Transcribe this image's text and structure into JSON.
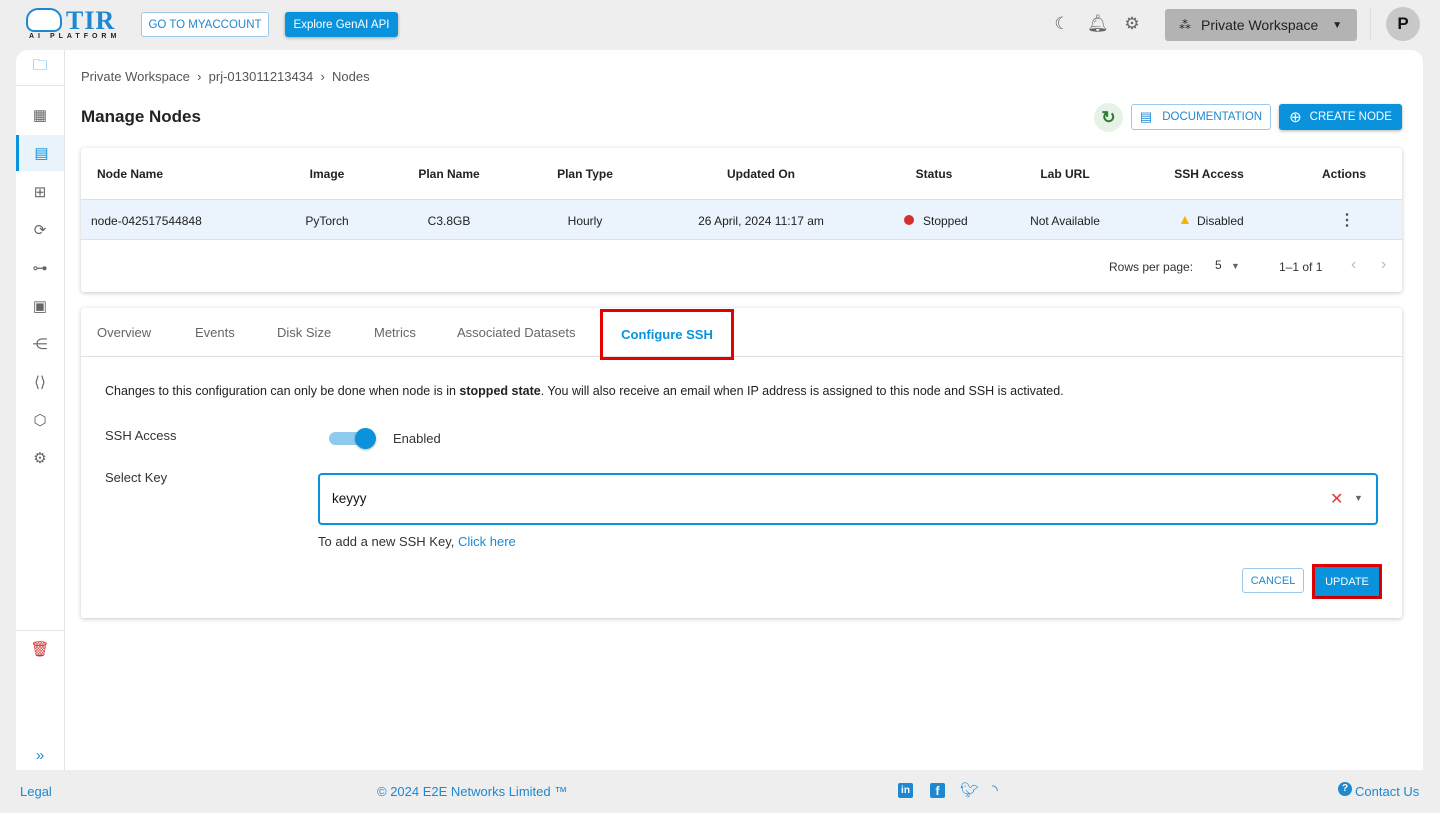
{
  "header": {
    "logo_text": "TIR",
    "logo_sub": "AI PLATFORM",
    "myaccount": "GO TO MYACCOUNT",
    "genai": "Explore GenAI API",
    "workspace": "Private Workspace",
    "avatar": "P"
  },
  "breadcrumb": [
    "Private Workspace",
    "prj-013011213434",
    "Nodes"
  ],
  "page": {
    "title": "Manage Nodes",
    "documentation": "DOCUMENTATION",
    "create": "CREATE NODE"
  },
  "table": {
    "columns": [
      "Node Name",
      "Image",
      "Plan Name",
      "Plan Type",
      "Updated On",
      "Status",
      "Lab URL",
      "SSH Access",
      "Actions"
    ],
    "rows": [
      {
        "name": "node-042517544848",
        "image": "PyTorch",
        "plan": "C3.8GB",
        "type": "Hourly",
        "updated": "26 April, 2024 11:17 am",
        "status": "Stopped",
        "lab": "Not Available",
        "ssh": "Disabled"
      }
    ],
    "rows_per_page_label": "Rows per page:",
    "rows_per_page": "5",
    "range": "1–1 of 1"
  },
  "tabs": [
    "Overview",
    "Events",
    "Disk Size",
    "Metrics",
    "Associated Datasets",
    "Configure SSH"
  ],
  "ssh": {
    "info_pre": "Changes to this configuration can only be done when node is in ",
    "info_bold": "stopped state",
    "info_post": ". You will also receive an email when IP address is assigned to this node and SSH is activated.",
    "access_label": "SSH Access",
    "toggle_state": "Enabled",
    "toggle_on": true,
    "key_label": "Select Key",
    "key_value": "keyyy",
    "add_text": "To add a new SSH Key, ",
    "add_link": "Click here",
    "cancel": "CANCEL",
    "update": "UPDATE"
  },
  "footer": {
    "legal": "Legal",
    "copyright": "© 2024 E2E Networks Limited ™",
    "contact": "Contact Us"
  },
  "colors": {
    "accent": "#0a93dc",
    "stopped": "#d32f2f",
    "warning": "#f5b400",
    "highlight": "#e60000"
  }
}
